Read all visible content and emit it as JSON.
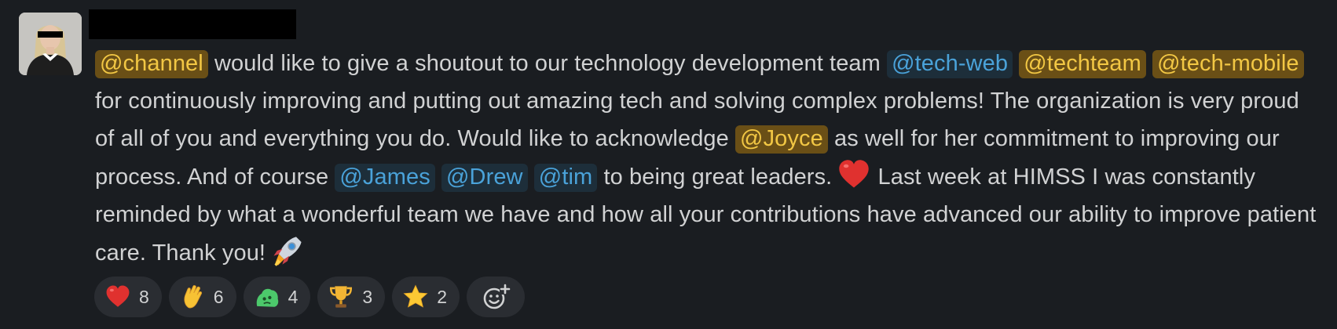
{
  "message": {
    "segments": {
      "s1": "@channel",
      "s2": " would like to give a shoutout to our technology development team ",
      "s3": "@tech-web",
      "s4": " ",
      "s5": "@techteam",
      "s6": " ",
      "s7": "@tech-mobile",
      "s8": " for continuously improving and putting out amazing tech and solving complex problems! The organization is very proud of all of you and everything you do. Would like to acknowledge ",
      "s9": "@Joyce",
      "s10": " as well for her commitment to improving our process. And of course ",
      "s11": "@James",
      "s12": " ",
      "s13": "@Drew",
      "s14": " ",
      "s15": "@tim",
      "s16": " to being great leaders.",
      "s17": " Last week at HIMSS I was constantly reminded by what a wonderful team we have and how all your contributions have advanced our ability to improve patient care. Thank you!"
    },
    "inline_emojis": [
      "heart",
      "rocket"
    ]
  },
  "reactions": [
    {
      "emoji": "heart",
      "count": "8"
    },
    {
      "emoji": "clap-hand",
      "count": "6"
    },
    {
      "emoji": "green-blob",
      "count": "4"
    },
    {
      "emoji": "trophy",
      "count": "3"
    },
    {
      "emoji": "star",
      "count": "2"
    }
  ],
  "colors": {
    "background": "#1a1d21",
    "text": "#d1d2d3",
    "user_mention_bg": "#1d2e3a",
    "user_mention_text": "#4aa2d9",
    "broadcast_mention_bg": "#6a4f16",
    "broadcast_mention_text": "#f2c744",
    "reaction_bg": "#2a2d32"
  }
}
